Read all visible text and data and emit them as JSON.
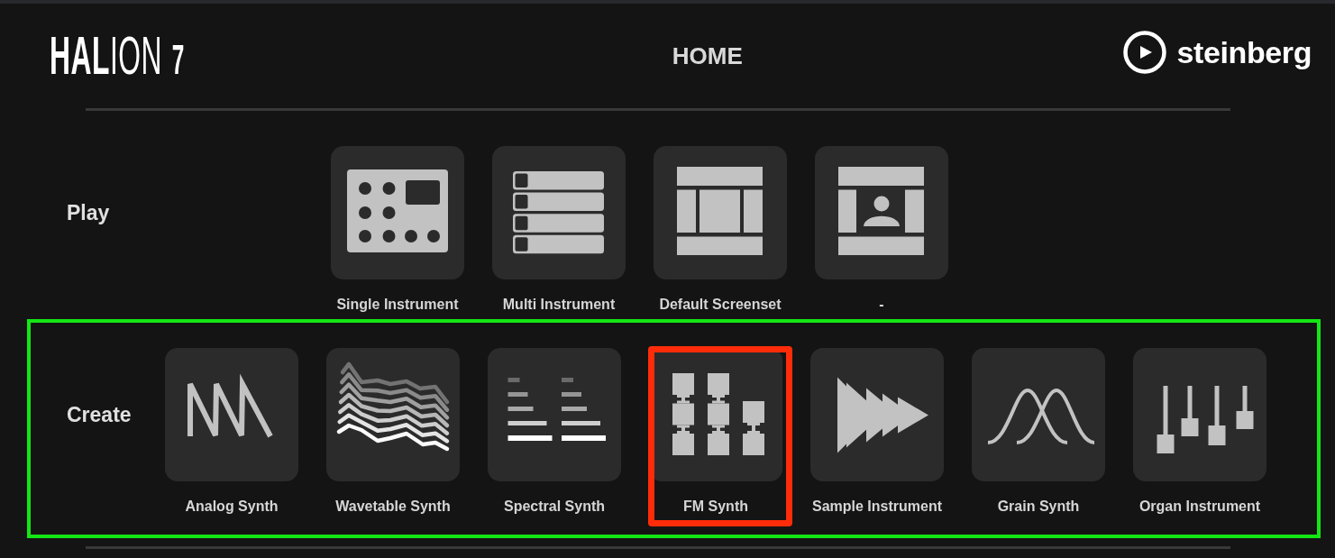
{
  "header": {
    "logo": "**HAL**ION",
    "version": "7",
    "title": "HOME",
    "brand": "steinberg"
  },
  "sections": [
    {
      "label": "Play",
      "highlighted": false,
      "tiles": [
        {
          "kind": "keypad",
          "label": "Single Instrument",
          "highlighted": false
        },
        {
          "kind": "rows",
          "label": "Multi Instrument",
          "highlighted": false
        },
        {
          "kind": "layout",
          "label": "Default Screenset",
          "highlighted": false
        },
        {
          "kind": "portrait",
          "label": "-",
          "highlighted": false
        }
      ]
    },
    {
      "label": "Create",
      "highlighted": true,
      "tiles": [
        {
          "kind": "sawtooth",
          "label": "Analog Synth",
          "highlighted": false
        },
        {
          "kind": "wavetable",
          "label": "Wavetable Synth",
          "highlighted": false
        },
        {
          "kind": "spectrum",
          "label": "Spectral Synth",
          "highlighted": false
        },
        {
          "kind": "blocks",
          "label": "FM Synth",
          "highlighted": true
        },
        {
          "kind": "arrows",
          "label": "Sample Instrument",
          "highlighted": false
        },
        {
          "kind": "bells",
          "label": "Grain Synth",
          "highlighted": false
        },
        {
          "kind": "faders",
          "label": "Organ Instrument",
          "highlighted": false
        }
      ]
    }
  ]
}
